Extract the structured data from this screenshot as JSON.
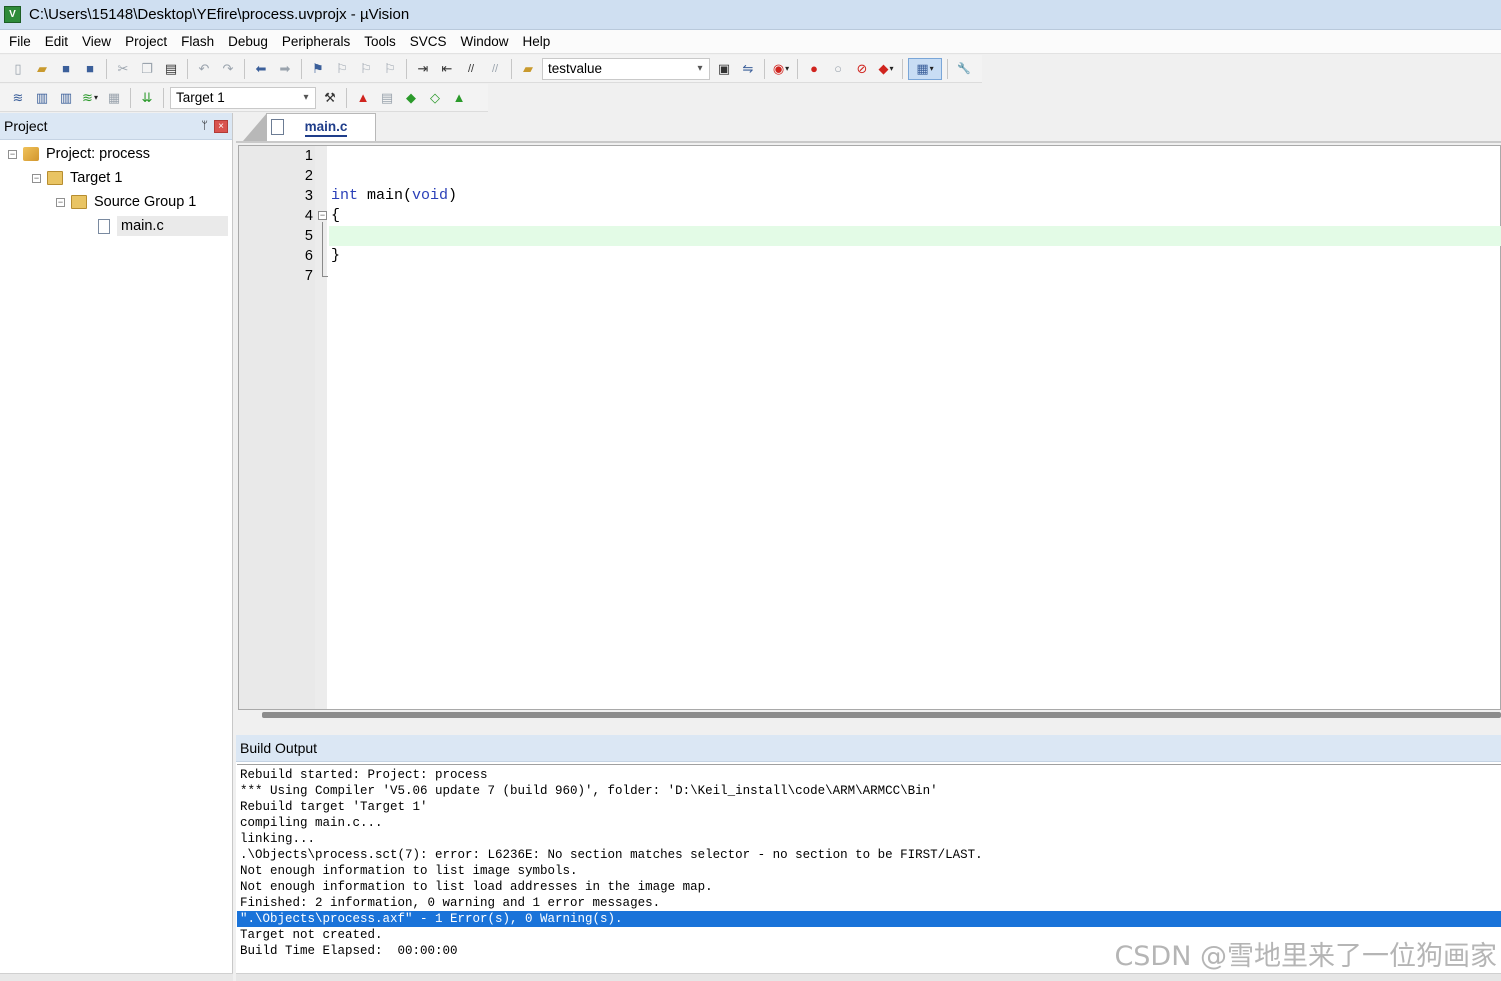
{
  "window": {
    "title": "C:\\Users\\15148\\Desktop\\YEfire\\process.uvprojx - µVision",
    "icon_letter": "V"
  },
  "menu": [
    "File",
    "Edit",
    "View",
    "Project",
    "Flash",
    "Debug",
    "Peripherals",
    "Tools",
    "SVCS",
    "Window",
    "Help"
  ],
  "toolbar": {
    "find_combo_value": "testvalue",
    "target_combo_value": "Target 1",
    "icons": {
      "new": "▯",
      "open": "▰",
      "save": "■",
      "save_all": "■",
      "cut": "✂",
      "copy": "❐",
      "paste": "▤",
      "undo": "↶",
      "redo": "↷",
      "nav_back": "⬅",
      "nav_forward": "➡",
      "bookmark": "⚑",
      "bookmark_prev": "⚐",
      "bookmark_next": "⚐",
      "bookmark_clear": "⚐",
      "indent": "⇥",
      "unindent": "⇤",
      "comment": "//",
      "uncomment": "//",
      "find_in_files": "▣",
      "incremental_find": "⇋",
      "debug_session": "◉",
      "breakpoint": "●",
      "breakpoint_disable": "○",
      "breakpoint_kill": "⊘",
      "breakpoint_all": "◆",
      "window_layout": "▦",
      "configure": "🔧",
      "translate": "≋",
      "build": "▥",
      "rebuild": "▥",
      "batch_build": "≋",
      "stop_build": "▦",
      "download": "⇊",
      "target_options": "⚒",
      "manage_components": "▲",
      "run_time_env": "▤",
      "pack_installer": "◆",
      "select_packs": "◇",
      "software_packs": "▲"
    },
    "dropdown_glyph": "▾"
  },
  "project_panel": {
    "title": "Project",
    "pin_glyph": "ᛘ",
    "close_glyph": "×",
    "expand_glyph": "−",
    "tree": {
      "project": "Project: process",
      "target": "Target 1",
      "group": "Source Group 1",
      "file": "main.c"
    }
  },
  "editor": {
    "tab_label": "main.c",
    "fold_glyph": "−",
    "lines": [
      {
        "num": "1",
        "code": ""
      },
      {
        "num": "2",
        "code": ""
      },
      {
        "num": "3",
        "code_kw1": "int",
        "code_mid": " main(",
        "code_kw2": "void",
        "code_end": ")"
      },
      {
        "num": "4",
        "code": "{"
      },
      {
        "num": "5",
        "code": ""
      },
      {
        "num": "6",
        "code": "}"
      },
      {
        "num": "7",
        "code": ""
      }
    ]
  },
  "build_output": {
    "title": "Build Output",
    "lines": [
      "Rebuild started: Project: process",
      "*** Using Compiler 'V5.06 update 7 (build 960)', folder: 'D:\\Keil_install\\code\\ARM\\ARMCC\\Bin'",
      "Rebuild target 'Target 1'",
      "compiling main.c...",
      "linking...",
      ".\\Objects\\process.sct(7): error: L6236E: No section matches selector - no section to be FIRST/LAST.",
      "Not enough information to list image symbols.",
      "Not enough information to list load addresses in the image map.",
      "Finished: 2 information, 0 warning and 1 error messages.",
      "\".\\Objects\\process.axf\" - 1 Error(s), 0 Warning(s).",
      "Target not created.",
      "Build Time Elapsed:  00:00:00"
    ],
    "highlighted_index": 9
  },
  "watermark": "CSDN @雪地里来了一位狗画家",
  "colors": {
    "selection": "#1a73d9",
    "current_line": "#e3fbe6",
    "keyword": "#2a3fb8"
  }
}
